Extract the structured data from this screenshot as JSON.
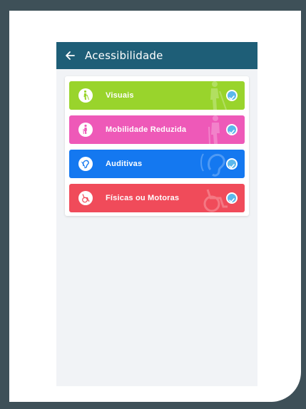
{
  "app_bar": {
    "title": "Acessibilidade",
    "background": "#1e5e77"
  },
  "options": [
    {
      "label": "Visuais",
      "color": "#99d42c",
      "icon": "person-with-cane-icon",
      "checked": true
    },
    {
      "label": "Mobilidade Reduzida",
      "color": "#ee59b8",
      "icon": "person-with-crutch-icon",
      "checked": true
    },
    {
      "label": "Auditivas",
      "color": "#1478f0",
      "icon": "ear-icon",
      "checked": true
    },
    {
      "label": "Físicas ou Motoras",
      "color": "#f04b5a",
      "icon": "wheelchair-icon",
      "checked": true
    }
  ],
  "check_color": "#5bb8ec"
}
